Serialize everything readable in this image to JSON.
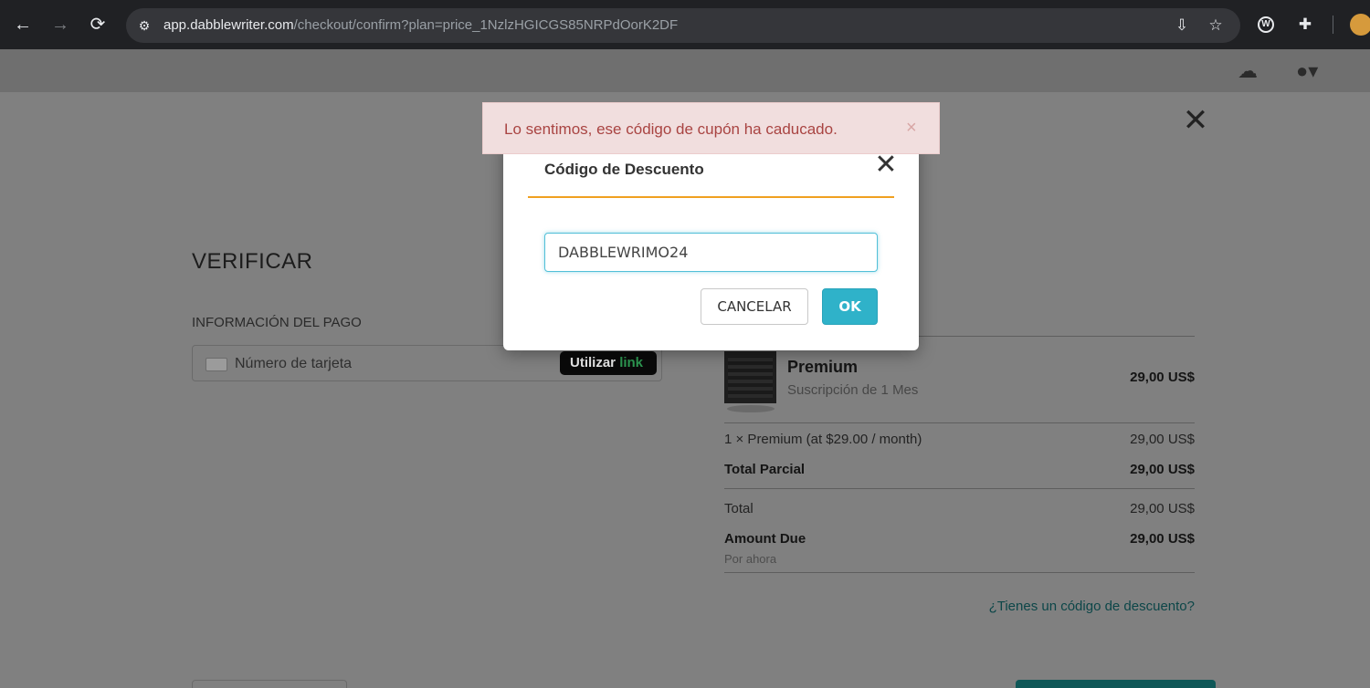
{
  "browser": {
    "url_host": "app.dabblewriter.com",
    "url_path": "/checkout/confirm?plan=price_1NzlzHGICGS85NRPdOorK2DF",
    "icons": [
      "back-icon",
      "forward-icon",
      "reload-icon",
      "site-info-icon",
      "install-icon",
      "star-icon",
      "extension-w-icon",
      "puzzle-icon"
    ]
  },
  "header": {
    "icons": [
      "cloud-sync-icon",
      "account-icon"
    ]
  },
  "page": {
    "close_symbol": "✕",
    "title": "VERIFICAR",
    "payment_label": "INFORMACIÓN DEL PAGO",
    "card_placeholder": "Número de tarjeta",
    "link_button": {
      "prefix": "Utilizar",
      "brand": "link"
    }
  },
  "summary": {
    "product_name": "Premium",
    "product_sub": "Suscripción de 1 Mes",
    "product_price": "29,00 US$",
    "line_item_label": "1 × Premium (at $29.00 / month)",
    "line_item_value": "29,00 US$",
    "subtotal_label": "Total Parcial",
    "subtotal_value": "29,00 US$",
    "total_label": "Total",
    "total_value": "29,00 US$",
    "amount_due_label": "Amount Due",
    "amount_due_value": "29,00 US$",
    "amount_due_note": "Por ahora",
    "discount_link": "¿Tienes un código de descuento?"
  },
  "toast": {
    "message": "Lo sentimos, ese código de cupón ha caducado.",
    "close_symbol": "×",
    "colors": {
      "background": "#f1dede",
      "text": "#a94442"
    }
  },
  "modal": {
    "title": "Código de Descuento",
    "close_symbol": "✕",
    "input_value": "DABBLEWRIMO24",
    "cancel_label": "CANCELAR",
    "ok_label": "OK",
    "colors": {
      "accent_rule": "#f0a020",
      "ok_button": "#2fb2c9",
      "input_focus": "#52c0d8"
    }
  }
}
